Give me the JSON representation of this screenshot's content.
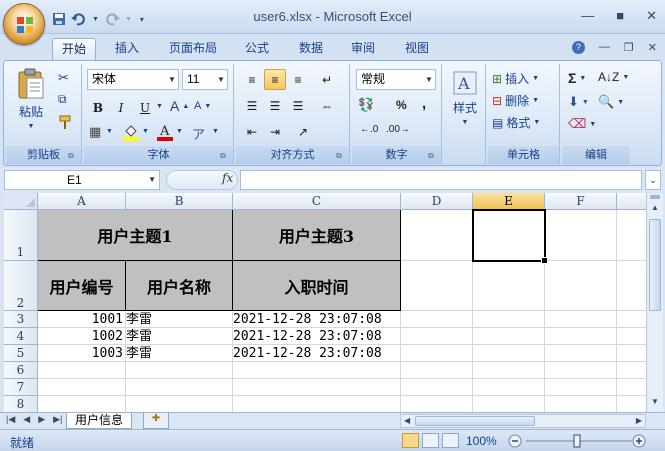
{
  "window": {
    "title": "user6.xlsx - Microsoft Excel"
  },
  "tabs": [
    "开始",
    "插入",
    "页面布局",
    "公式",
    "数据",
    "审阅",
    "视图"
  ],
  "ribbon": {
    "clipboard": {
      "paste": "粘贴",
      "label": "剪贴板"
    },
    "font": {
      "name": "宋体",
      "size": "11",
      "label": "字体",
      "bold": "B",
      "italic": "I",
      "underline": "U"
    },
    "alignment": {
      "label": "对齐方式"
    },
    "number": {
      "format": "常规",
      "percent": "%",
      "comma": ",",
      "label": "数字"
    },
    "styles": {
      "label": "样式"
    },
    "cells": {
      "insert": "插入",
      "delete": "删除",
      "format": "格式",
      "label": "单元格"
    },
    "editing": {
      "label": "编辑",
      "sum": "Σ"
    }
  },
  "formula_bar": {
    "name_box": "E1",
    "fx": "fx",
    "value": ""
  },
  "columns": [
    "A",
    "B",
    "C",
    "D",
    "E",
    "F"
  ],
  "rows": [
    "1",
    "2",
    "3",
    "4",
    "5",
    "6",
    "7",
    "8"
  ],
  "sheet": {
    "merged_headers": {
      "group1": "用户主题1",
      "group3": "用户主题3",
      "col_a": "用户编号",
      "col_b": "用户名称",
      "col_c": "入职时间"
    },
    "data": [
      {
        "id": "1001",
        "name": "李雷",
        "time": "2021-12-28 23:07:08"
      },
      {
        "id": "1002",
        "name": "李雷",
        "time": "2021-12-28 23:07:08"
      },
      {
        "id": "1003",
        "name": "李雷",
        "time": "2021-12-28 23:07:08"
      }
    ],
    "selected_cell": "E1"
  },
  "sheet_tabs": [
    "用户信息"
  ],
  "status": {
    "text": "就绪",
    "zoom": "100%"
  }
}
